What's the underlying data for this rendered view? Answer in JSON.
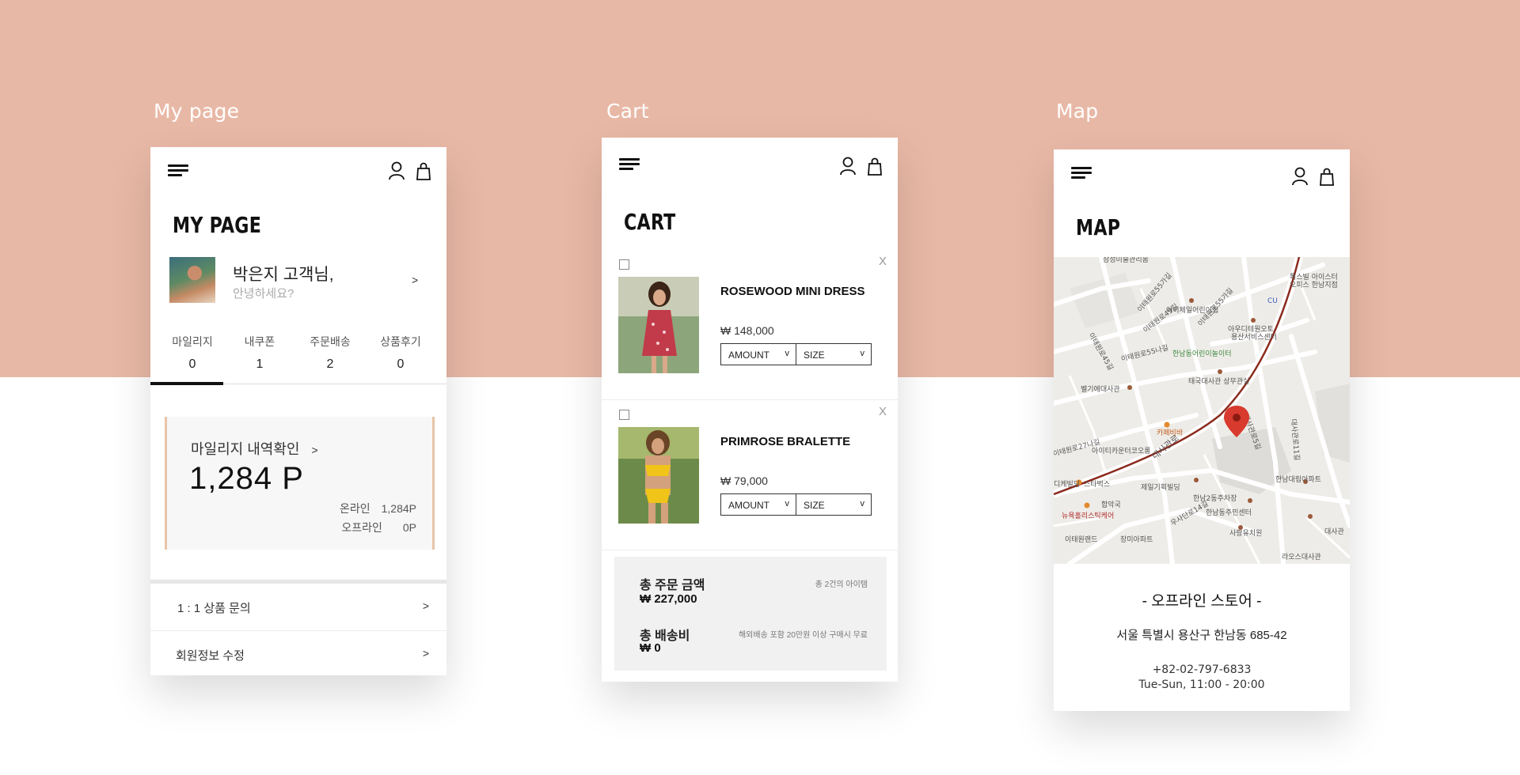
{
  "sections": {
    "mypage_title": "My page",
    "cart_title": "Cart",
    "map_title": "Map"
  },
  "colors": {
    "backdrop": "#e8b8a6",
    "mileage_border": "#e8c4a8",
    "map_pin": "#d83a2e"
  },
  "icons": {
    "menu": "hamburger-icon",
    "user": "user-icon",
    "bag": "shopping-bag-icon",
    "pin": "map-pin-icon"
  },
  "mypage": {
    "heading": "MY PAGE",
    "profile": {
      "name": "박은지 고객님,",
      "greeting": "안녕하세요?",
      "arrow": ">"
    },
    "stats": [
      {
        "label": "마일리지",
        "value": "0"
      },
      {
        "label": "내쿠폰",
        "value": "1"
      },
      {
        "label": "주문배송",
        "value": "2"
      },
      {
        "label": "상품후기",
        "value": "0"
      }
    ],
    "mileage": {
      "title": "마일리지 내역확인",
      "arrow": ">",
      "points": "1,284 P",
      "online_label": "온라인",
      "online_value": "1,284P",
      "offline_label": "오프라인",
      "offline_value": "0P"
    },
    "menu": [
      {
        "label": "1 : 1 상품 문의",
        "arrow": ">"
      },
      {
        "label": "회원정보 수정",
        "arrow": ">"
      }
    ]
  },
  "cart": {
    "heading": "CART",
    "items": [
      {
        "name": "ROSEWOOD MINI DRESS",
        "price": "₩ 148,000",
        "remove": "X",
        "amount_label": "AMOUNT",
        "size_label": "SIZE",
        "chevron": "v"
      },
      {
        "name": "PRIMROSE BRALETTE",
        "price": "₩ 79,000",
        "remove": "X",
        "amount_label": "AMOUNT",
        "size_label": "SIZE",
        "chevron": "v"
      }
    ],
    "summary": {
      "total_label": "총 주문 금액",
      "total_value": "₩ 227,000",
      "total_note": "총 2건의 아이템",
      "shipping_label": "총 배송비",
      "shipping_value": "₩ 0",
      "shipping_note": "해외배송 포함 20만원 이상 구매시 무료"
    }
  },
  "map": {
    "heading": "MAP",
    "labels": [
      "삼성미술관리움",
      "이태원로55가길",
      "이태원로49길",
      "이태원로55가길",
      "이태원로45길",
      "이태원로55나길",
      "이태원로27나길",
      "대사관로",
      "대사관로5길",
      "대사관로11길",
      "우사단로14길",
      "한남동어린이놀이터",
      "벨기에대사관",
      "태국대사관 상무관실",
      "카페비바",
      "아이티카운터코오롱",
      "스타벅스",
      "제일기획빌딩",
      "한남2동주차장",
      "한남동주민센터",
      "합악국",
      "이태원랜드",
      "장미아파트",
      "사랑유치원",
      "라오스대사관",
      "한남대림아파트",
      "뉴욕홀리스틱케어",
      "디케빌딩",
      "아이체일어린이집",
      "아우디테원오토",
      "용산서비스센터",
      "CU",
      "톡스빌 아이스터",
      "오피스 한남지점",
      "대사관"
    ],
    "store_title": "- 오프라인 스토어 -",
    "address": "서울 특별시 용산구 한남동 685-42",
    "phone": "+82-02-797-6833",
    "hours": "Tue-Sun, 11:00 - 20:00"
  }
}
